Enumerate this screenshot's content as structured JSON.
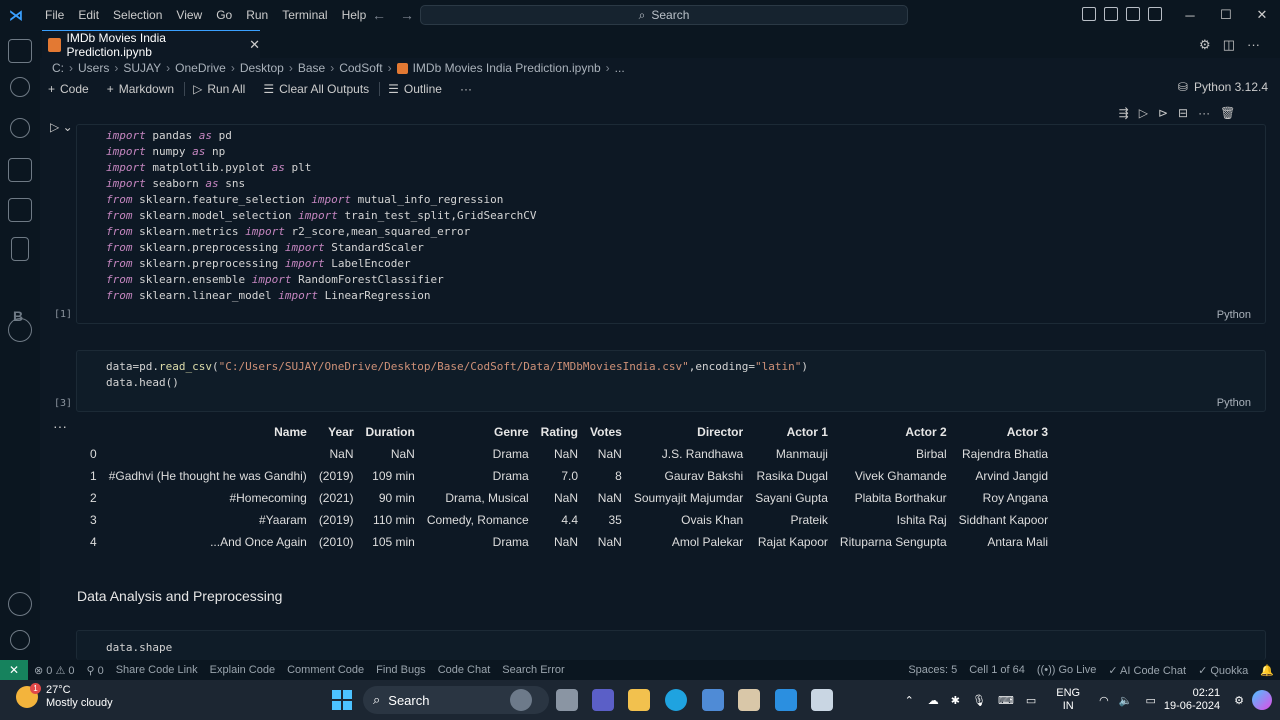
{
  "titlebar": {
    "menu": [
      "File",
      "Edit",
      "Selection",
      "View",
      "Go",
      "Run",
      "Terminal",
      "Help"
    ],
    "search_label": "Search"
  },
  "tab": {
    "title": "IMDb Movies India Prediction.ipynb"
  },
  "breadcrumb": [
    "C:",
    "Users",
    "SUJAY",
    "OneDrive",
    "Desktop",
    "Base",
    "CodSoft",
    "IMDb Movies India Prediction.ipynb",
    "..."
  ],
  "toolbar": {
    "code": "Code",
    "markdown": "Markdown",
    "run_all": "Run All",
    "clear_all": "Clear All Outputs",
    "outline": "Outline",
    "more": "···",
    "kernel": "Python 3.12.4"
  },
  "cell1": {
    "exec_count": "[1]",
    "language": "Python",
    "lines": [
      {
        "kw1": "import",
        "t1": " pandas ",
        "kw2": "as",
        "t2": " pd"
      },
      {
        "kw1": "import",
        "t1": " numpy ",
        "kw2": "as",
        "t2": " np"
      },
      {
        "kw1": "import",
        "t1": " matplotlib.pyplot ",
        "kw2": "as",
        "t2": " plt"
      },
      {
        "kw1": "import",
        "t1": " seaborn ",
        "kw2": "as",
        "t2": " sns"
      },
      {
        "kw1": "from",
        "t1": " sklearn.feature_selection ",
        "kw2": "import",
        "t2": " mutual_info_regression"
      },
      {
        "kw1": "from",
        "t1": " sklearn.model_selection ",
        "kw2": "import",
        "t2": " train_test_split,GridSearchCV"
      },
      {
        "kw1": "from",
        "t1": " sklearn.metrics ",
        "kw2": "import",
        "t2": " r2_score,mean_squared_error"
      },
      {
        "kw1": "from",
        "t1": " sklearn.preprocessing ",
        "kw2": "import",
        "t2": " StandardScaler"
      },
      {
        "kw1": "from",
        "t1": " sklearn.preprocessing ",
        "kw2": "import",
        "t2": " LabelEncoder"
      },
      {
        "kw1": "from",
        "t1": " sklearn.ensemble ",
        "kw2": "import",
        "t2": " RandomForestClassifier"
      },
      {
        "kw1": "from",
        "t1": " sklearn.linear_model ",
        "kw2": "import",
        "t2": " LinearRegression"
      }
    ]
  },
  "cell2": {
    "exec_count": "[3]",
    "language": "Python",
    "line1_a": "data=pd.",
    "line1_fn": "read_csv",
    "line1_b": "(",
    "line1_str": "\"C:/Users/SUJAY/OneDrive/Desktop/Base/CodSoft/Data/IMDbMoviesIndia.csv\"",
    "line1_c": ",encoding=",
    "line1_str2": "\"latin\"",
    "line1_d": ")",
    "line2": "data.head()"
  },
  "output_table": {
    "columns": [
      "",
      "Name",
      "Year",
      "Duration",
      "Genre",
      "Rating",
      "Votes",
      "Director",
      "Actor 1",
      "Actor 2",
      "Actor 3"
    ],
    "rows": [
      [
        "0",
        "",
        "NaN",
        "NaN",
        "Drama",
        "NaN",
        "NaN",
        "J.S. Randhawa",
        "Manmauji",
        "Birbal",
        "Rajendra Bhatia"
      ],
      [
        "1",
        "#Gadhvi (He thought he was Gandhi)",
        "(2019)",
        "109 min",
        "Drama",
        "7.0",
        "8",
        "Gaurav Bakshi",
        "Rasika Dugal",
        "Vivek Ghamande",
        "Arvind Jangid"
      ],
      [
        "2",
        "#Homecoming",
        "(2021)",
        "90 min",
        "Drama, Musical",
        "NaN",
        "NaN",
        "Soumyajit Majumdar",
        "Sayani Gupta",
        "Plabita Borthakur",
        "Roy Angana"
      ],
      [
        "3",
        "#Yaaram",
        "(2019)",
        "110 min",
        "Comedy, Romance",
        "4.4",
        "35",
        "Ovais Khan",
        "Prateik",
        "Ishita Raj",
        "Siddhant Kapoor"
      ],
      [
        "4",
        "...And Once Again",
        "(2010)",
        "105 min",
        "Drama",
        "NaN",
        "NaN",
        "Amol Palekar",
        "Rajat Kapoor",
        "Rituparna Sengupta",
        "Antara Mali"
      ]
    ]
  },
  "markdown_heading": "Data Analysis and Preprocessing",
  "cell3": {
    "line1": "data.shape"
  },
  "statusbar": {
    "problems": "⊗ 0 ⚠ 0",
    "ports": "⚲ 0",
    "left_items": [
      "Share Code Link",
      "Explain Code",
      "Comment Code",
      "Find Bugs",
      "Code Chat",
      "Search Error"
    ],
    "spaces": "Spaces: 5",
    "cell": "Cell 1 of 64",
    "golive": "Go Live",
    "aichat": "AI Code Chat",
    "quokka": "Quokka"
  },
  "taskbar": {
    "temp": "27°C",
    "weather": "Mostly cloudy",
    "badge": "1",
    "search": "Search",
    "lang_line1": "ENG",
    "lang_line2": "IN",
    "time": "02:21",
    "date": "19-06-2024"
  }
}
